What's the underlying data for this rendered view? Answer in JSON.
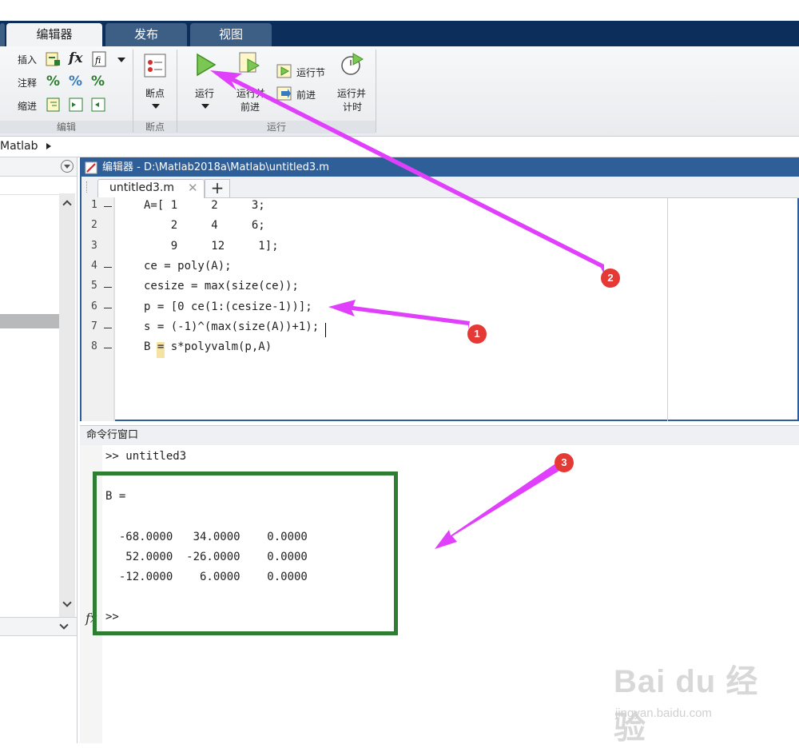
{
  "ribbon": {
    "tabs": [
      {
        "label": "编辑器",
        "active": true
      },
      {
        "label": "发布",
        "active": false
      },
      {
        "label": "视图",
        "active": false
      }
    ],
    "edit_group": {
      "insert_label": "插入",
      "comment_label": "注释",
      "indent_label": "缩进",
      "group_label": "编辑"
    },
    "breakpoint_group": {
      "breakpoint_label": "断点",
      "group_label": "断点"
    },
    "run_group": {
      "run_label": "运行",
      "run_advance_label_1": "运行并",
      "run_advance_label_2": "前进",
      "run_section_label": "运行节",
      "advance_label": "前进",
      "run_time_label_1": "运行并",
      "run_time_label_2": "计时",
      "group_label": "运行"
    }
  },
  "address": {
    "path": "Matlab"
  },
  "editor": {
    "title": "编辑器 - D:\\Matlab2018a\\Matlab\\untitled3.m",
    "file_tab": "untitled3.m",
    "add_tab": "+",
    "lines": [
      {
        "num": "1",
        "bp": true,
        "code": "A=[ 1     2     3;"
      },
      {
        "num": "2",
        "bp": false,
        "code": "    2     4     6;"
      },
      {
        "num": "3",
        "bp": false,
        "code": "    9     12     1];"
      },
      {
        "num": "4",
        "bp": true,
        "code": "ce = poly(A);"
      },
      {
        "num": "5",
        "bp": true,
        "code": "cesize = max(size(ce));"
      },
      {
        "num": "6",
        "bp": true,
        "code": "p = [0 ce(1:(cesize-1))];"
      },
      {
        "num": "7",
        "bp": true,
        "code": "s = (-1)^(max(size(A))+1);"
      },
      {
        "num": "8",
        "bp": true,
        "code": "B = s*polyvalm(p,A)"
      }
    ]
  },
  "command_window": {
    "title": "命令行窗口",
    "prompt_line": ">> untitled3",
    "result_name": "B =",
    "matrix": [
      "  -68.0000   34.0000    0.0000",
      "   52.0000  -26.0000    0.0000",
      "  -12.0000    6.0000    0.0000"
    ],
    "final_prompt": ">>",
    "fx": "fx"
  },
  "annotations": {
    "badge_1": "1",
    "badge_2": "2",
    "badge_3": "3",
    "arrow_color": "#e040fb",
    "box_color": "#2e7d32"
  },
  "watermark": {
    "brand": "Bai du 经验",
    "url": "jingyan.baidu.com"
  },
  "colors": {
    "tab_bar": "#0b2e5a",
    "editor_title": "#2f5f98",
    "badge": "#e53935"
  }
}
